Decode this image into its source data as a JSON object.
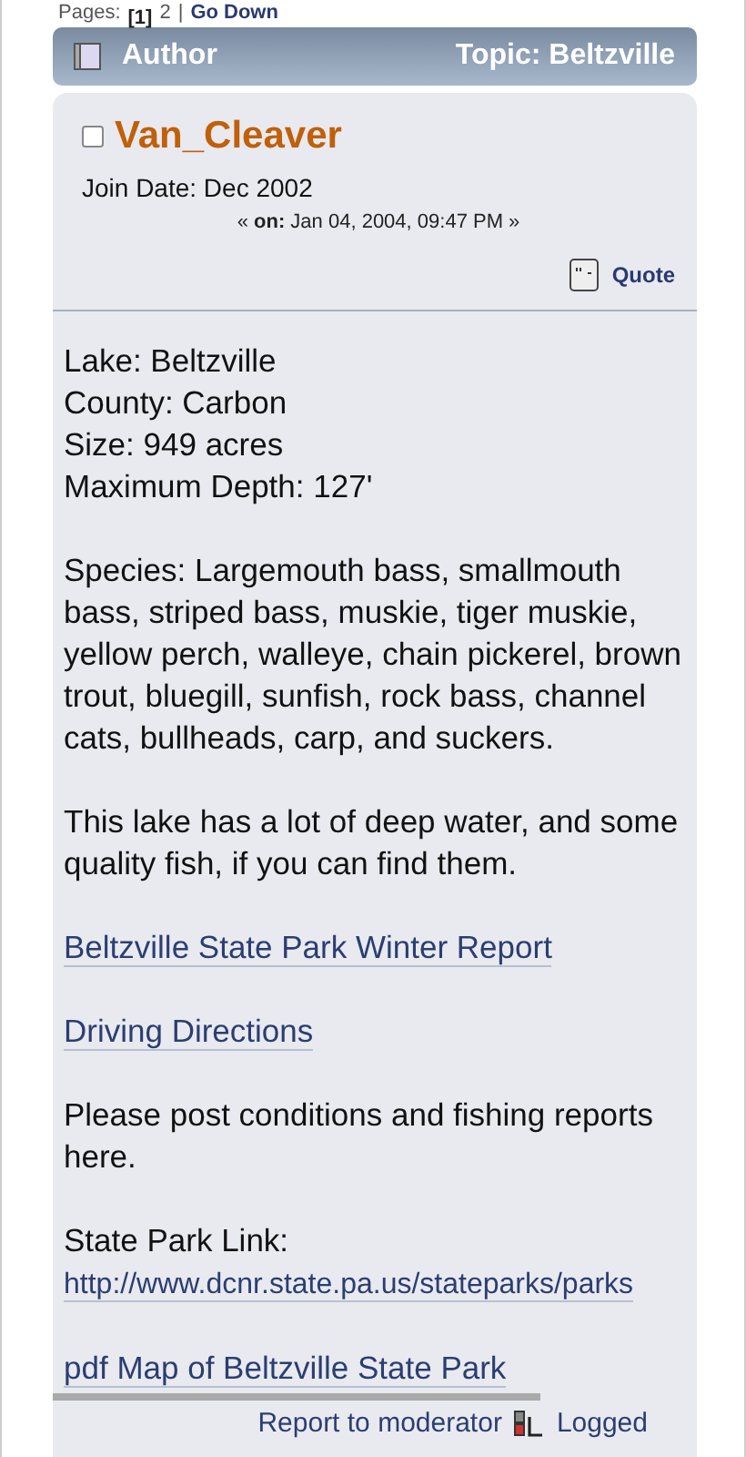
{
  "pagination": {
    "label": "Pages:",
    "pages": [
      {
        "text": "[1]",
        "selected": true
      },
      {
        "text": "2",
        "selected": false
      }
    ],
    "separator": "|",
    "go_down": "Go Down"
  },
  "header": {
    "author_label": "Author",
    "topic": "Topic: Beltzville"
  },
  "post": {
    "author": "Van_Cleaver",
    "online": false,
    "join_date": "Join Date: Dec 2002",
    "posted_prefix": "« **on:** Jan 04, 2004, 09:47 PM »",
    "quote": "Quote",
    "body": [
      {
        "kind": "lines",
        "lines": [
          "Lake: Beltzville",
          "County: Carbon",
          "Size: 949 acres",
          "Maximum Depth: 127'"
        ]
      },
      {
        "kind": "text",
        "text": "Species: Largemouth bass, smallmouth bass, striped bass, muskie, tiger muskie, yellow perch, walleye, chain pickerel, brown trout, bluegill, sunfish, rock bass, channel cats, bullheads, carp, and suckers."
      },
      {
        "kind": "text",
        "text": "This lake has a lot of deep water, and some quality fish, if you can find them."
      },
      {
        "kind": "link",
        "text": "Beltzville State Park Winter Report"
      },
      {
        "kind": "link",
        "text": "Driving Directions"
      },
      {
        "kind": "text",
        "text": "Please post conditions and fishing reports here."
      },
      {
        "kind": "labeled_link",
        "label": "State Park Link:",
        "text": "http://www.dcnr.state.pa.us/stateparks/parks"
      },
      {
        "kind": "link",
        "text": "pdf Map of Beltzville State Park"
      }
    ],
    "report": "Report to moderator",
    "logged": "Logged"
  }
}
